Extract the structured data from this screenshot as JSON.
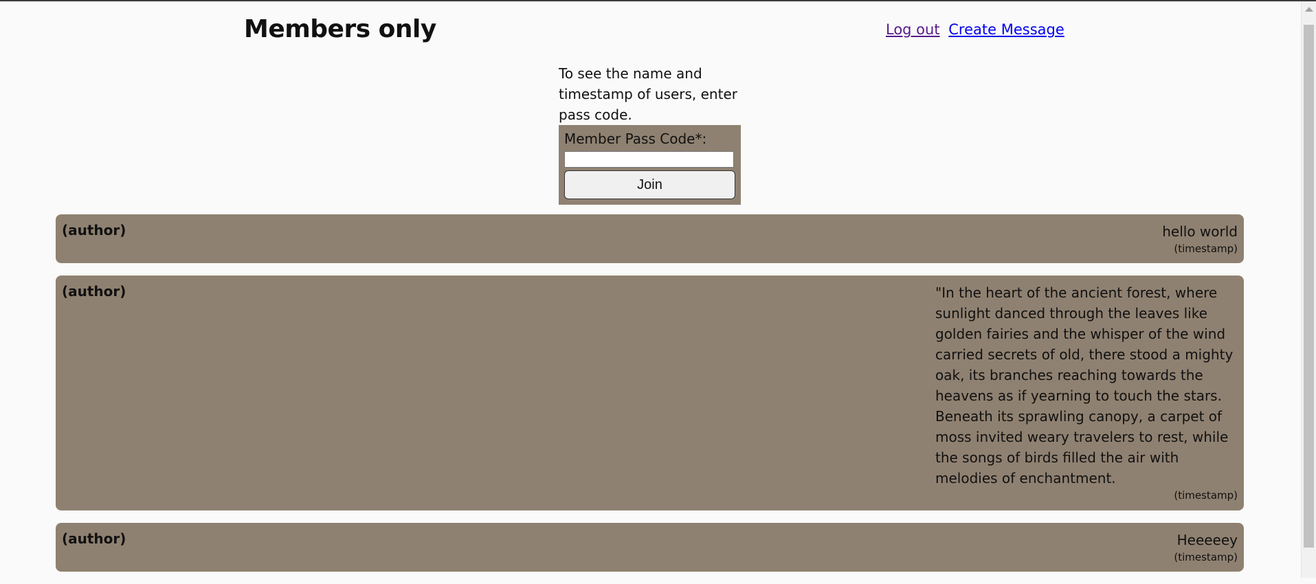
{
  "header": {
    "title": "Members only",
    "nav": {
      "logout_label": "Log out",
      "create_message_label": "Create Message"
    }
  },
  "passcode": {
    "intro": "To see the name and timestamp of users, enter pass code.",
    "label": "Member Pass Code*:",
    "value": "",
    "button_label": "Join"
  },
  "messages": [
    {
      "author": "(author)",
      "text": "hello world",
      "timestamp": "(timestamp)"
    },
    {
      "author": "(author)",
      "text": "\"In the heart of the ancient forest, where sunlight danced through the leaves like golden fairies and the whisper of the wind carried secrets of old, there stood a mighty oak, its branches reaching towards the heavens as if yearning to touch the stars. Beneath its sprawling canopy, a carpet of moss invited weary travelers to rest, while the songs of birds filled the air with melodies of enchantment.",
      "timestamp": "(timestamp)"
    },
    {
      "author": "(author)",
      "text": "Heeeeey",
      "timestamp": "(timestamp)"
    }
  ],
  "colors": {
    "card_background": "#8f8171",
    "page_background": "#fafafa",
    "link_visited": "#551a8b",
    "link": "#0000ee"
  }
}
